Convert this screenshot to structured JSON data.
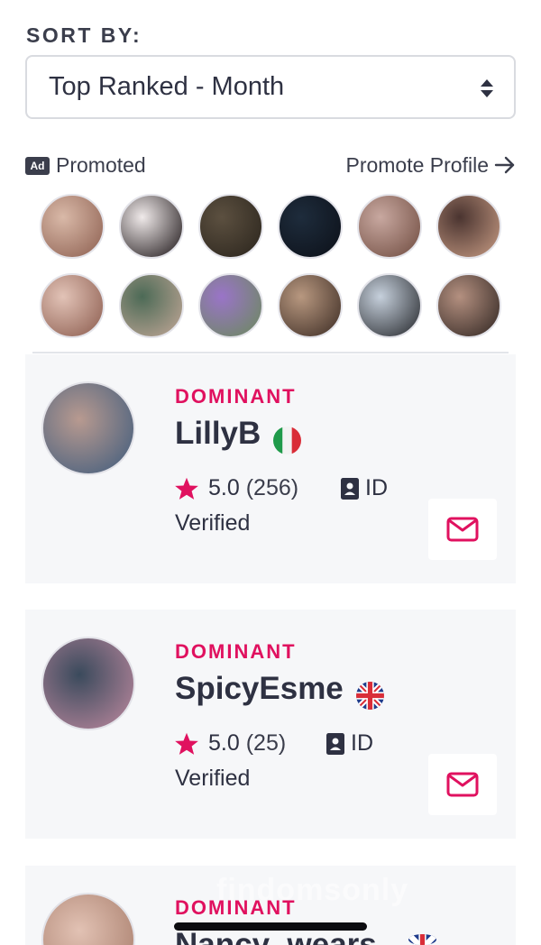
{
  "sort": {
    "label": "SORT BY:",
    "selected": "Top Ranked - Month"
  },
  "promo": {
    "badge": "Ad",
    "label": "Promoted",
    "link": "Promote Profile"
  },
  "thumbs": [
    {
      "colors": [
        "#d9b9a8",
        "#8c5e4f"
      ]
    },
    {
      "colors": [
        "#f0eaea",
        "#1b1416"
      ]
    },
    {
      "colors": [
        "#5c5040",
        "#2a241c"
      ]
    },
    {
      "colors": [
        "#1e2c3c",
        "#0c1018"
      ]
    },
    {
      "colors": [
        "#c8a8a0",
        "#6e4a3e"
      ]
    },
    {
      "colors": [
        "#4a3430",
        "#c89c84"
      ]
    },
    {
      "colors": [
        "#e2c3b7",
        "#8a5a4c"
      ]
    },
    {
      "colors": [
        "#4c6a56",
        "#c4a898"
      ]
    },
    {
      "colors": [
        "#9a74c8",
        "#6a8a5a"
      ]
    },
    {
      "colors": [
        "#b89880",
        "#3a2a22"
      ]
    },
    {
      "colors": [
        "#c6d0dc",
        "#222428"
      ]
    },
    {
      "colors": [
        "#b49080",
        "#2e2420"
      ]
    }
  ],
  "listings": [
    {
      "category": "DOMINANT",
      "name": "LillyB",
      "flag": "italy",
      "rating": "5.0",
      "reviews": "(256)",
      "id_label": "ID",
      "verified": "Verified",
      "avatar_colors": [
        "#b89a90",
        "#3c5a7c"
      ]
    },
    {
      "category": "DOMINANT",
      "name": "SpicyEsme",
      "flag": "uk",
      "rating": "5.0",
      "reviews": "(25)",
      "id_label": "ID",
      "verified": "Verified",
      "avatar_colors": [
        "#3a4a5c",
        "#c08aa0"
      ]
    },
    {
      "category": "DOMINANT",
      "name": "Nancy_wears",
      "flag": "uk",
      "avatar_colors": [
        "#e2c2b4",
        "#a57a68"
      ]
    }
  ],
  "watermark": "findomsonly"
}
